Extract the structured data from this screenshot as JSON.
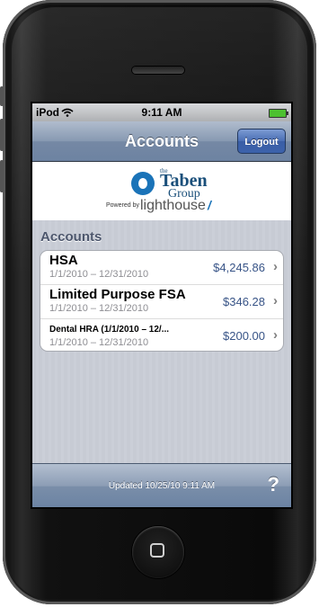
{
  "status": {
    "carrier": "iPod",
    "time": "9:11 AM"
  },
  "nav": {
    "title": "Accounts",
    "logout_label": "Logout"
  },
  "brand": {
    "the": "the",
    "name": "Taben",
    "group": "Group",
    "powered_by": "Powered by",
    "product": "lighthouse",
    "product_mark": "/"
  },
  "accounts": {
    "section_title": "Accounts",
    "rows": [
      {
        "name": "HSA",
        "dates": "1/1/2010 – 12/31/2010",
        "amount": "$4,245.86"
      },
      {
        "name": "Limited Purpose FSA",
        "dates": "1/1/2010 – 12/31/2010",
        "amount": "$346.28"
      },
      {
        "name": "Dental HRA (1/1/2010 – 12/...",
        "dates": "1/1/2010 – 12/31/2010",
        "amount": "$200.00"
      }
    ]
  },
  "toolbar": {
    "updated": "Updated 10/25/10 9:11 AM",
    "help_label": "?"
  },
  "colors": {
    "nav_accent": "#6d83a2",
    "logout_button": "#4a6eb4",
    "amount_text": "#385487",
    "brand_blue": "#1a73b8"
  },
  "icons": [
    "wifi-icon",
    "battery-icon",
    "chevron-right-icon",
    "help-icon",
    "home-button-icon"
  ]
}
